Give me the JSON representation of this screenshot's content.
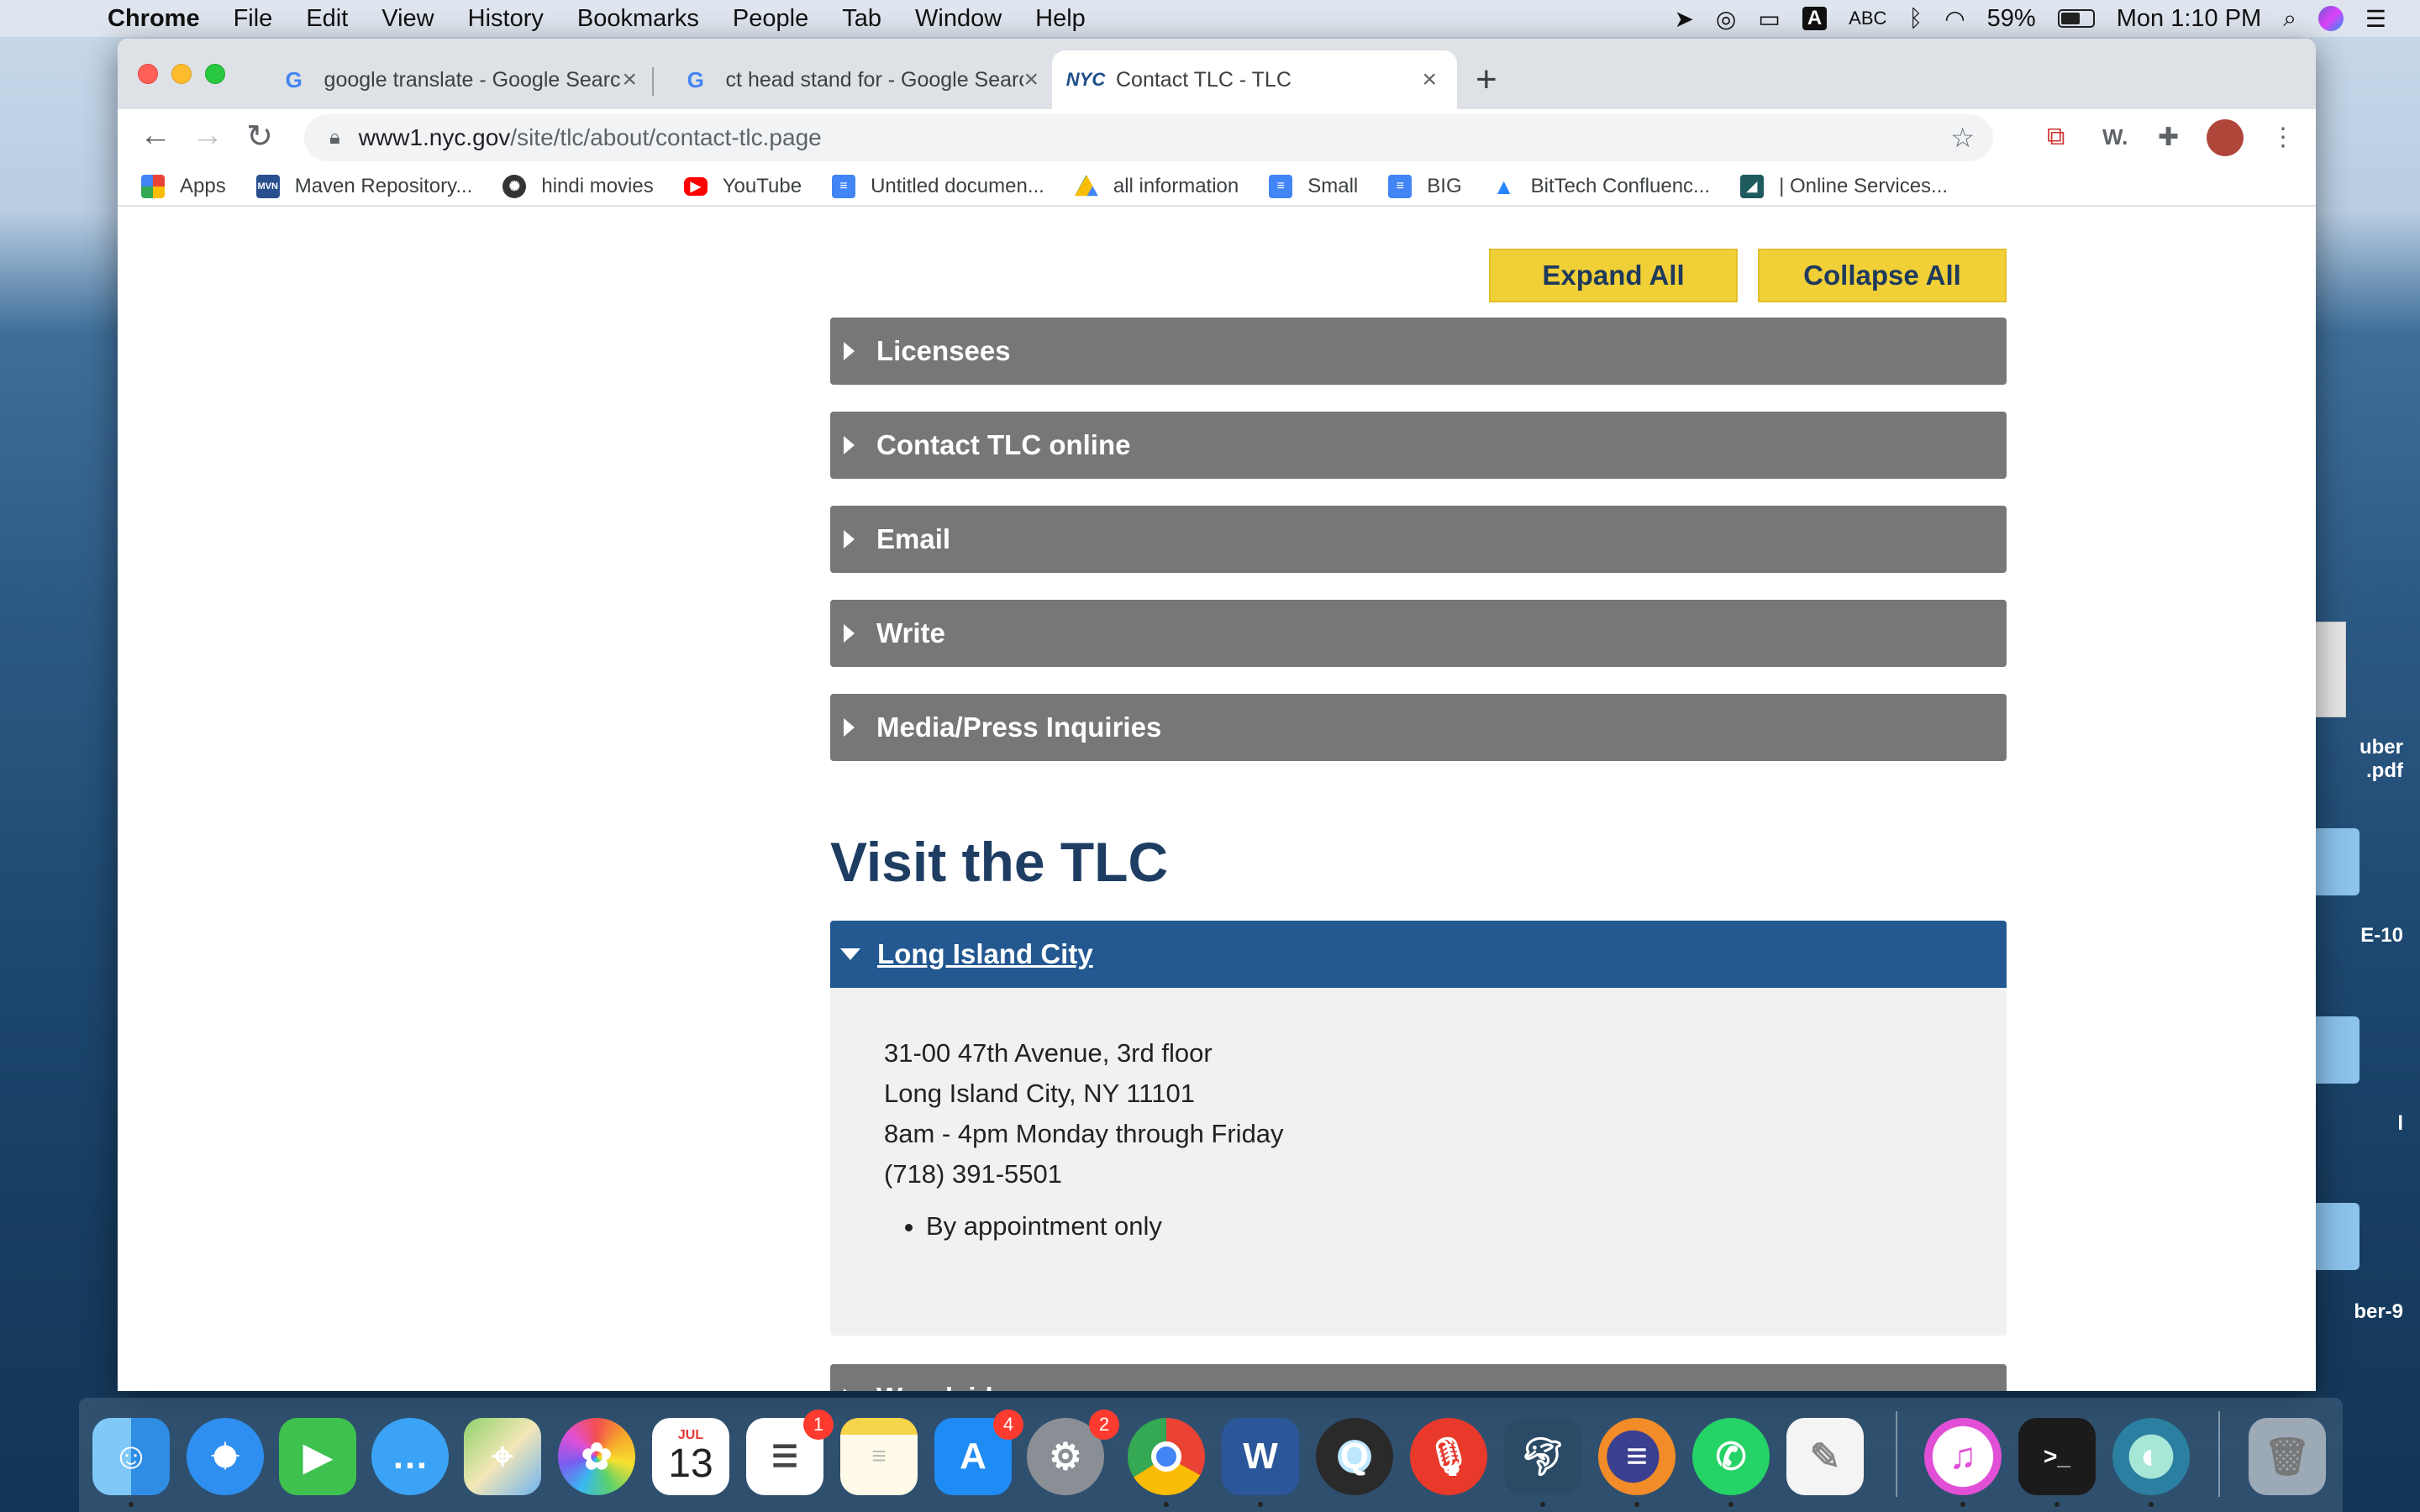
{
  "menubar": {
    "items": [
      "Chrome",
      "File",
      "Edit",
      "View",
      "History",
      "Bookmarks",
      "People",
      "Tab",
      "Window",
      "Help"
    ],
    "battery": "59%",
    "clock": "Mon 1:10 PM",
    "input_source": "ABC"
  },
  "desktop": {
    "files": [
      {
        "label_line1": "uber",
        "label_line2": ".pdf"
      },
      {
        "label": "E-10"
      },
      {
        "label": "l"
      },
      {
        "label": "ber-9"
      }
    ]
  },
  "browser": {
    "tabs": [
      {
        "title": "google translate - Google Search",
        "favicon": "google-icon"
      },
      {
        "title": "ct head stand for - Google Search",
        "favicon": "google-icon"
      },
      {
        "title": "Contact TLC - TLC",
        "favicon": "nyc-icon",
        "active": true
      }
    ],
    "url_host": "www1.nyc.gov",
    "url_path": "/site/tlc/about/contact-tlc.page",
    "bookmarks": [
      {
        "label": "Apps",
        "icon": "apps-grid-icon"
      },
      {
        "label": "Maven Repository...",
        "icon": "maven-icon"
      },
      {
        "label": "hindi movies",
        "icon": "film-reel-icon"
      },
      {
        "label": "YouTube",
        "icon": "youtube-icon"
      },
      {
        "label": "Untitled documen...",
        "icon": "google-docs-icon"
      },
      {
        "label": "all information",
        "icon": "google-drive-icon"
      },
      {
        "label": "Small",
        "icon": "google-docs-icon"
      },
      {
        "label": "BIG",
        "icon": "google-docs-icon"
      },
      {
        "label": "BitTech Confluenc...",
        "icon": "atlassian-icon"
      },
      {
        "label": "| Online Services...",
        "icon": "ny-state-icon"
      }
    ]
  },
  "page": {
    "expand_all": "Expand All",
    "collapse_all": "Collapse All",
    "accordions_top": [
      "Licensees",
      "Contact TLC online",
      "Email",
      "Write",
      "Media/Press Inquiries"
    ],
    "visit_title": "Visit the TLC",
    "lic": {
      "title": "Long Island City",
      "address1": "31-00 47th Avenue, 3rd floor",
      "address2": "Long Island City, NY 11101",
      "hours": "8am - 4pm Monday through Friday",
      "phone": "(718) 391-5501",
      "note": "By appointment only"
    },
    "woodside": "Woodside"
  },
  "dock": {
    "badges": {
      "reminders": "1",
      "app_store": "4",
      "system_prefs": "2"
    },
    "calendar": {
      "month": "JUL",
      "day": "13"
    }
  }
}
